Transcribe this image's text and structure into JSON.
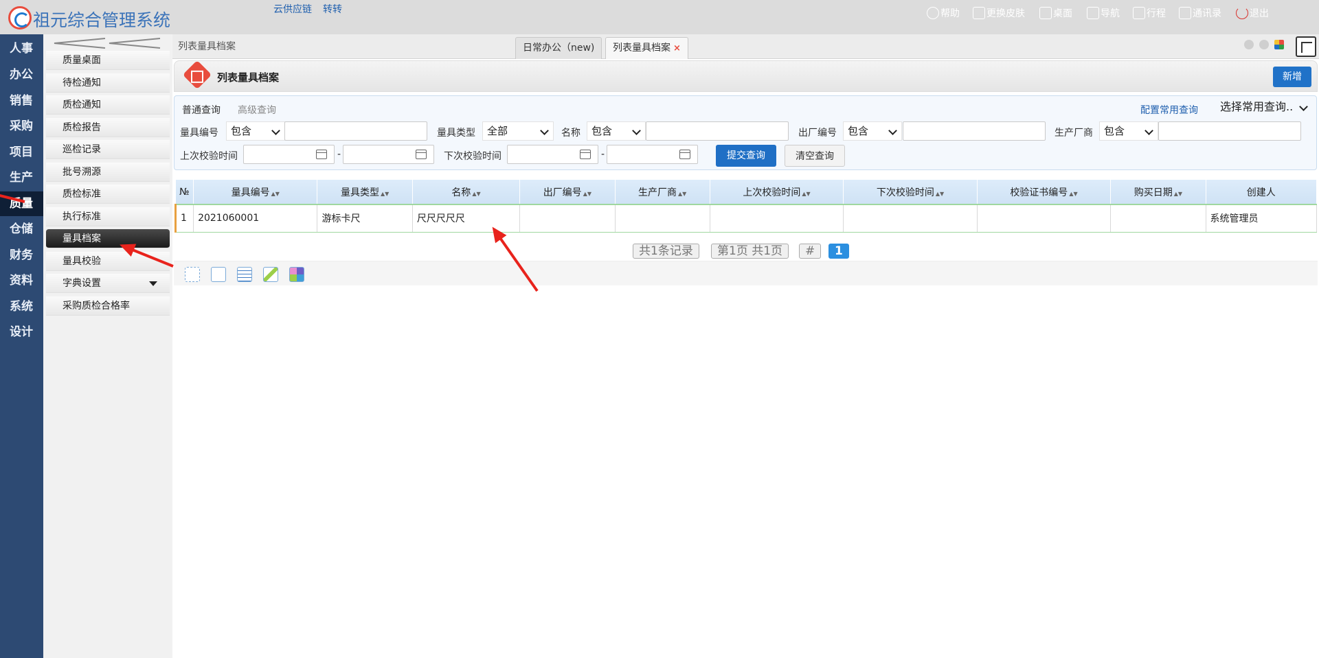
{
  "app": {
    "title": "祖元综合管理系统"
  },
  "top_links": [
    "云供应链",
    "转转"
  ],
  "top_right": [
    {
      "label": "帮助",
      "icon": "help-icon"
    },
    {
      "label": "更换皮肤",
      "icon": "shirt-icon"
    },
    {
      "label": "桌面",
      "icon": "home-icon"
    },
    {
      "label": "导航",
      "icon": "grid-icon"
    },
    {
      "label": "行程",
      "icon": "calendar-icon"
    },
    {
      "label": "通讯录",
      "icon": "contacts-icon"
    },
    {
      "label": "退出",
      "icon": "power-icon"
    }
  ],
  "left_nav": [
    "人事",
    "办公",
    "销售",
    "采购",
    "项目",
    "生产",
    "质量",
    "仓储",
    "财务",
    "资料",
    "系统",
    "设计"
  ],
  "left_nav_active": "质量",
  "submenu": [
    "质量桌面",
    "待检通知",
    "质检通知",
    "质检报告",
    "巡检记录",
    "批号溯源",
    "质检标准",
    "执行标准",
    "量具档案",
    "量具校验",
    "字典设置",
    "采购质检合格率"
  ],
  "submenu_active": "量具档案",
  "breadcrumb": "列表量具档案",
  "tabs": [
    {
      "label": "日常办公（new)"
    },
    {
      "label": "列表量具档案",
      "close": "×"
    }
  ],
  "page": {
    "title": "列表量具档案",
    "new_button": "新增"
  },
  "query": {
    "tab_normal": "普通查询",
    "tab_advanced": "高级查询",
    "config_link": "配置常用查询",
    "common_select": "选择常用查询..",
    "fields": {
      "code_label": "量具编号",
      "code_op": "包含",
      "type_label": "量具类型",
      "type_value": "全部",
      "name_label": "名称",
      "name_op": "包含",
      "factory_no_label": "出厂编号",
      "factory_no_op": "包含",
      "maker_label": "生产厂商",
      "maker_op": "包含",
      "last_check_label": "上次校验时间",
      "next_check_label": "下次校验时间",
      "range_sep": "-"
    },
    "submit": "提交查询",
    "clear": "清空查询"
  },
  "grid": {
    "columns": [
      "№",
      "量具编号",
      "量具类型",
      "名称",
      "出厂编号",
      "生产厂商",
      "上次校验时间",
      "下次校验时间",
      "校验证书编号",
      "购买日期",
      "创建人"
    ],
    "rows": [
      [
        "1",
        "2021060001",
        "游标卡尺",
        "尺尺尺尺尺",
        "",
        "",
        "",
        "",
        "",
        "",
        "系统管理员"
      ]
    ]
  },
  "pager": {
    "total": "共1条记录",
    "page_info": "第1页 共1页",
    "hash": "#",
    "current": "1"
  },
  "colors": {
    "nav_bg": "#2d4a73",
    "accent": "#2072c8",
    "annotation": "#e8231c"
  }
}
